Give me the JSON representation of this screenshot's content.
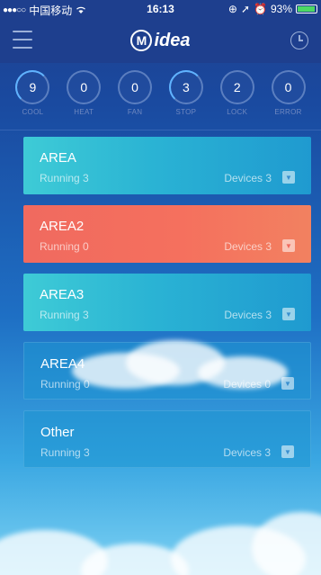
{
  "status_bar": {
    "signal": "●●●○○",
    "carrier": "中国移动",
    "wifi_icon": "wifi-icon",
    "time": "16:13",
    "battery": "93%",
    "battery_level": 0.93
  },
  "header": {
    "logo_text": "idea",
    "logo_letter": "M"
  },
  "stats": [
    {
      "value": "9",
      "label": "COOL",
      "active": true
    },
    {
      "value": "0",
      "label": "HEAT",
      "active": false
    },
    {
      "value": "0",
      "label": "FAN",
      "active": false
    },
    {
      "value": "3",
      "label": "STOP",
      "active": true
    },
    {
      "value": "2",
      "label": "LOCK",
      "active": false
    },
    {
      "value": "0",
      "label": "ERROR",
      "active": false
    }
  ],
  "areas": [
    {
      "name": "AREA",
      "running": "Running 3",
      "devices": "Devices 3",
      "color": "#2ab3d4"
    },
    {
      "name": "AREA2",
      "running": "Running 0",
      "devices": "Devices 3",
      "color": "#f06a5f"
    },
    {
      "name": "AREA3",
      "running": "Running 3",
      "devices": "Devices 3",
      "color": "#2ab3d4"
    },
    {
      "name": "AREA4",
      "running": "Running 0",
      "devices": "Devices 0",
      "color": "#1e96d2"
    },
    {
      "name": "Other",
      "running": "Running 3",
      "devices": "Devices 3",
      "color": "#1e96d2"
    }
  ],
  "colors": {
    "header_bg": "#1e3f8e",
    "accent_blue": "#2ab3d4",
    "accent_red": "#f06a5f"
  }
}
